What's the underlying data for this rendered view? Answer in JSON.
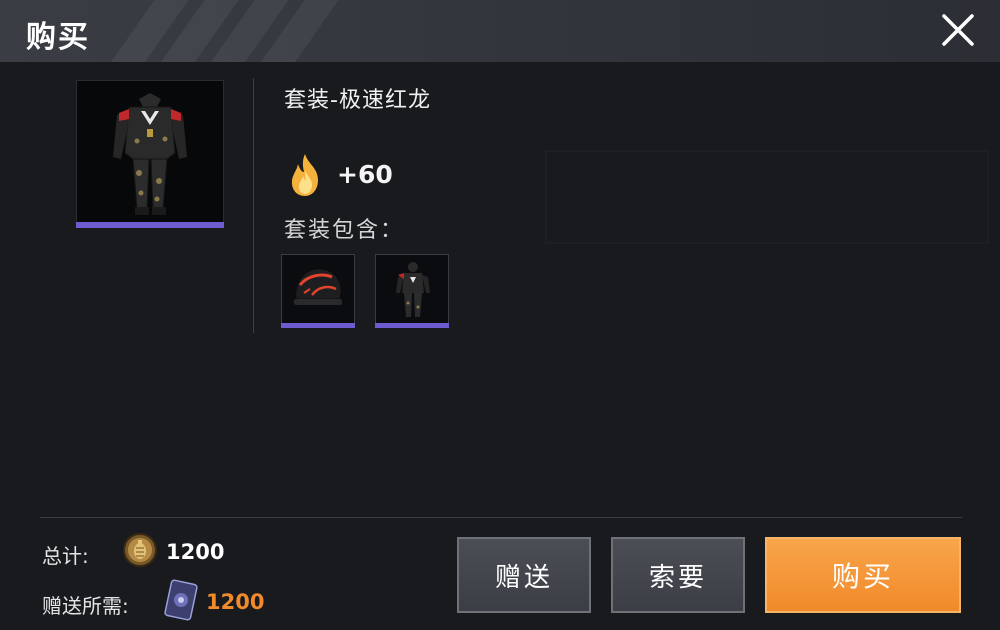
{
  "header": {
    "title": "购买",
    "close_icon": "close-icon"
  },
  "item": {
    "name": "套装-极速红龙",
    "score": "+60",
    "score_icon": "flame-icon",
    "contains_label": "套装包含：",
    "rarity_color": "#6b5ccf",
    "contents": [
      {
        "icon": "helmet-icon"
      },
      {
        "icon": "outfit-icon"
      }
    ]
  },
  "summary": {
    "total_label": "总计:",
    "total_icon": "coin-icon",
    "total_value": "1200",
    "gift_required_label": "赠送所需:",
    "gift_required_icon": "gift-card-icon",
    "gift_required_value": "1200"
  },
  "actions": {
    "gift_label": "赠送",
    "request_label": "索要",
    "buy_label": "购买"
  },
  "colors": {
    "accent": "#f08a2a",
    "rarity": "#6b5ccf",
    "panel_bg": "#1d1f24"
  }
}
